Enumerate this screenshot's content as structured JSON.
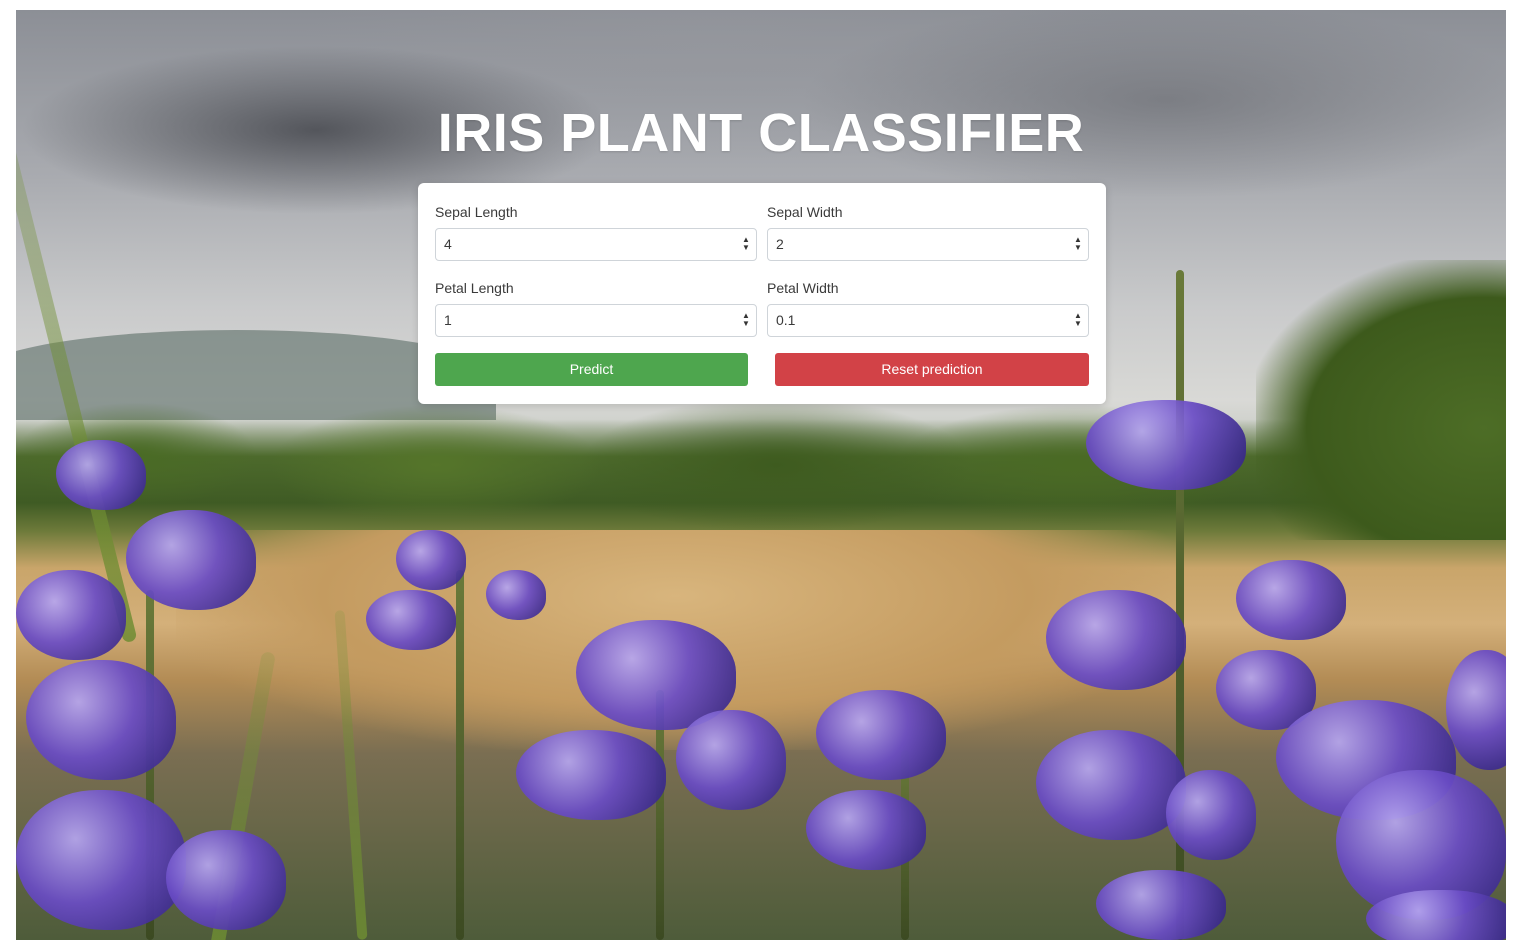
{
  "title": "IRIS PLANT CLASSIFIER",
  "form": {
    "sepal_length": {
      "label": "Sepal Length",
      "value": "4"
    },
    "sepal_width": {
      "label": "Sepal Width",
      "value": "2"
    },
    "petal_length": {
      "label": "Petal Length",
      "value": "1"
    },
    "petal_width": {
      "label": "Petal Width",
      "value": "0.1"
    }
  },
  "buttons": {
    "predict_label": "Predict",
    "reset_label": "Reset prediction"
  },
  "colors": {
    "predict": "#4ea64e",
    "reset": "#d24247",
    "title": "#ffffff"
  },
  "icons": {
    "select_arrows": "select-arrows-icon"
  }
}
